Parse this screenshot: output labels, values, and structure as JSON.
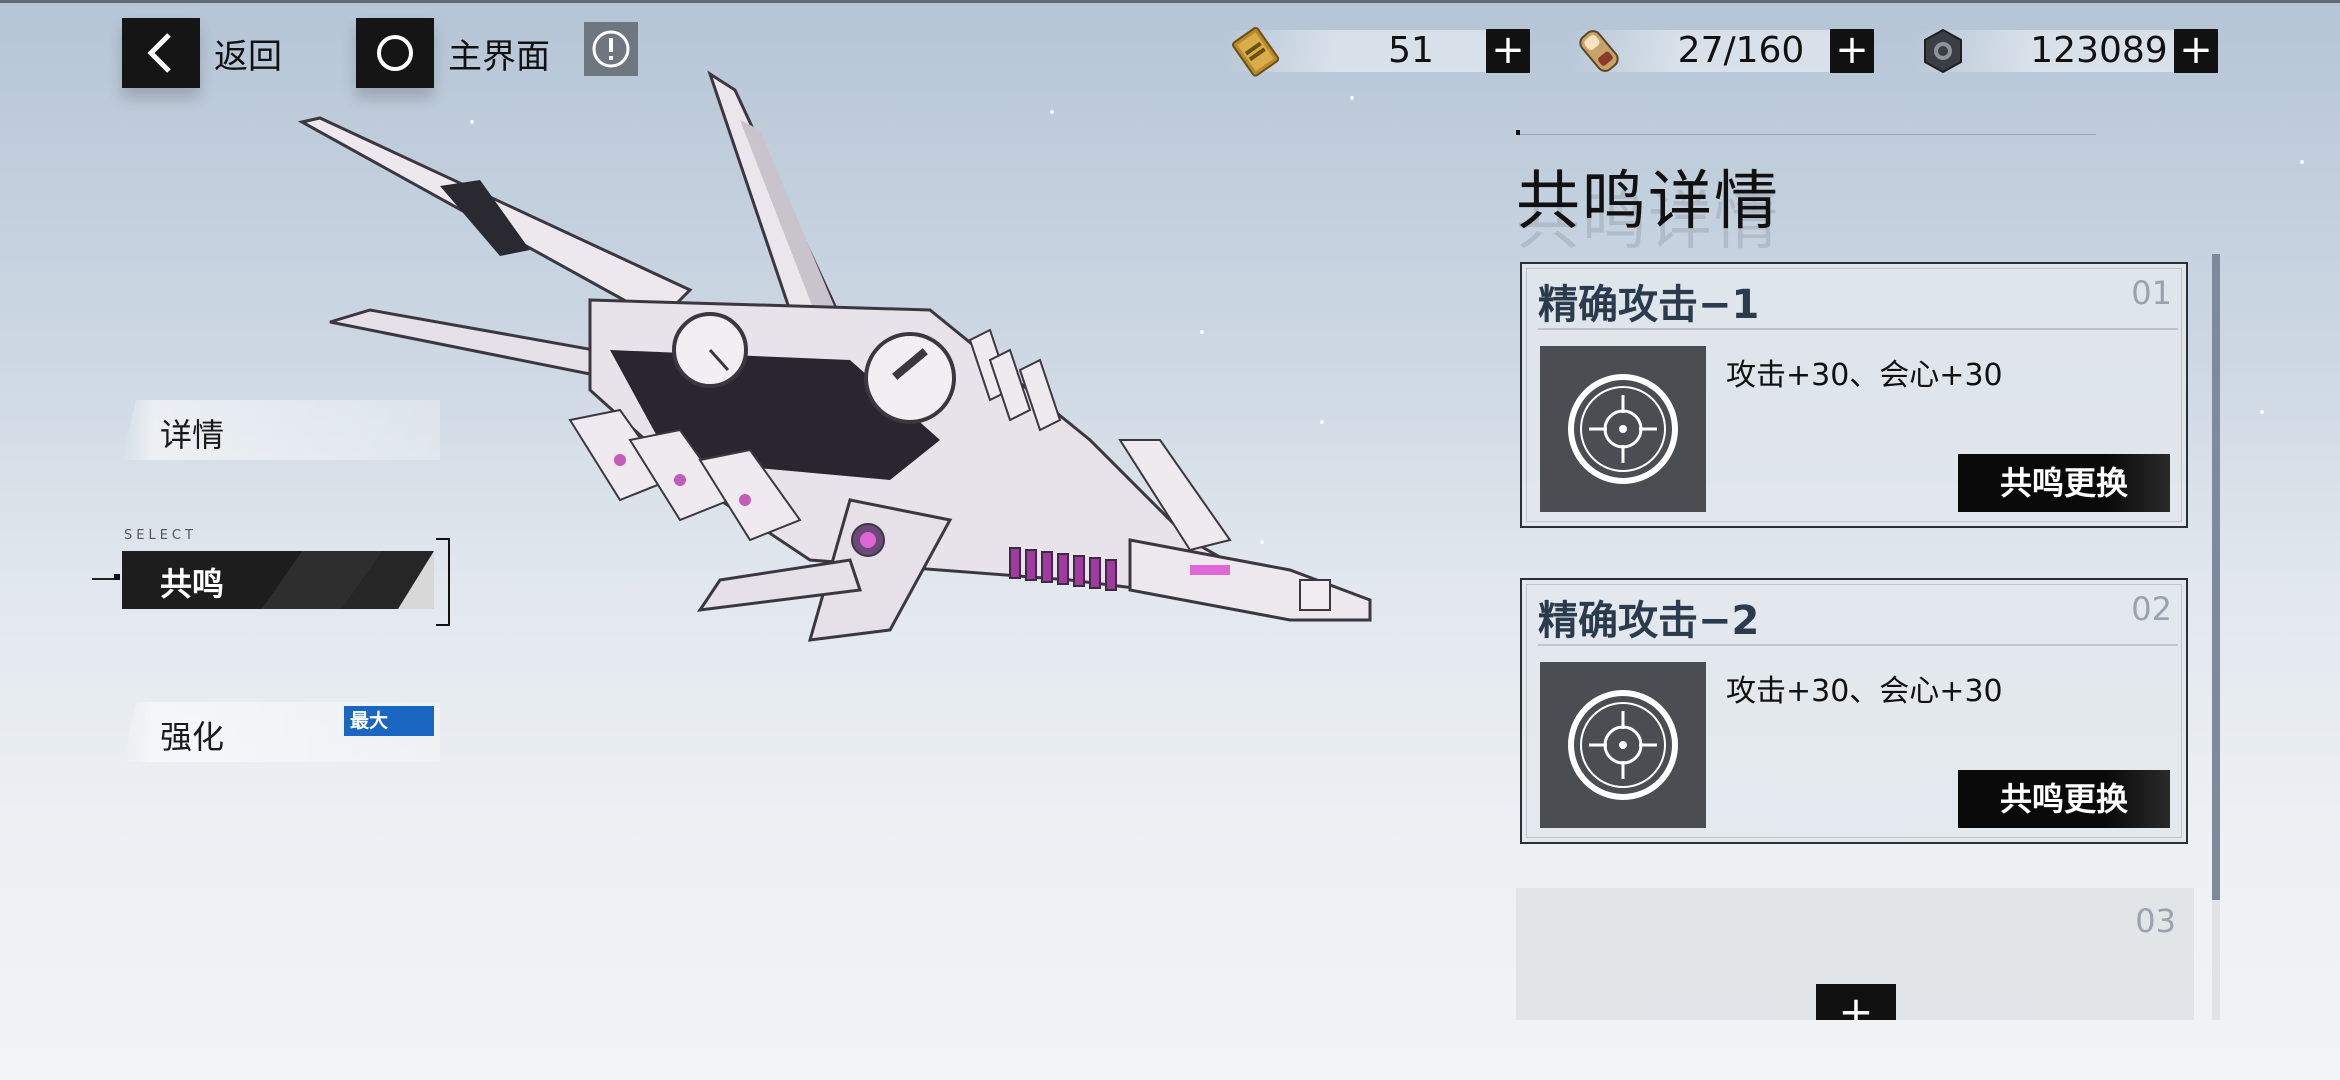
{
  "nav": {
    "back_label": "返回",
    "home_label": "主界面"
  },
  "currencies": [
    {
      "icon": "gold-ticket-icon",
      "value": "51"
    },
    {
      "icon": "battery-icon",
      "value": "27/160"
    },
    {
      "icon": "gear-coin-icon",
      "value": "123089"
    }
  ],
  "menu": {
    "select_tag": "SELECT",
    "items": [
      {
        "label": "详情"
      },
      {
        "label": "共鸣"
      },
      {
        "label": "强化",
        "badge": "最大"
      }
    ],
    "selected_index": 1
  },
  "panel": {
    "title": "共鸣详情",
    "cards": [
      {
        "name": "精确攻击−1",
        "num": "01",
        "desc": "攻击+30、会心+30",
        "button": "共鸣更换",
        "icon": "crosshair-icon"
      },
      {
        "name": "精确攻击−2",
        "num": "02",
        "desc": "攻击+30、会心+30",
        "button": "共鸣更换",
        "icon": "crosshair-icon"
      }
    ],
    "empty_slot": {
      "num": "03",
      "button": "+"
    }
  },
  "colors": {
    "accent_blue": "#1b66c0",
    "dark": "#111111",
    "card_title": "#2b3a4d"
  }
}
